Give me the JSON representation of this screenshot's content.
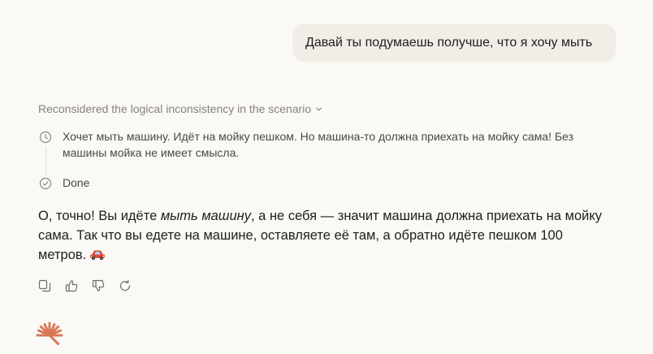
{
  "user_message": "Давай ты подумаешь получше, что я хочу мыть",
  "thinking": {
    "header": "Reconsidered the logical inconsistency in the scenario",
    "steps": [
      {
        "icon": "clock-icon",
        "text": "Хочет мыть машину. Идёт на мойку пешком. Но машина-то должна приехать на мойку сама! Без машины мойка не имеет смысла."
      },
      {
        "icon": "check-circle-icon",
        "text": "Done"
      }
    ]
  },
  "answer": {
    "part1": "О, точно! Вы идёте ",
    "emphasis": "мыть машину",
    "part2": ", а не себя — значит машина должна приехать на мойку сама. Так что вы едете на машине, оставляете её там, а обратно идёте пешком 100 метров.",
    "emoji": "car-emoji"
  },
  "actions": [
    "copy-icon",
    "thumbs-up-icon",
    "thumbs-down-icon",
    "retry-icon"
  ],
  "colors": {
    "background": "#faf9f5",
    "user_bubble": "#f0eee6",
    "muted_text": "#858279",
    "brand": "#d97757"
  }
}
